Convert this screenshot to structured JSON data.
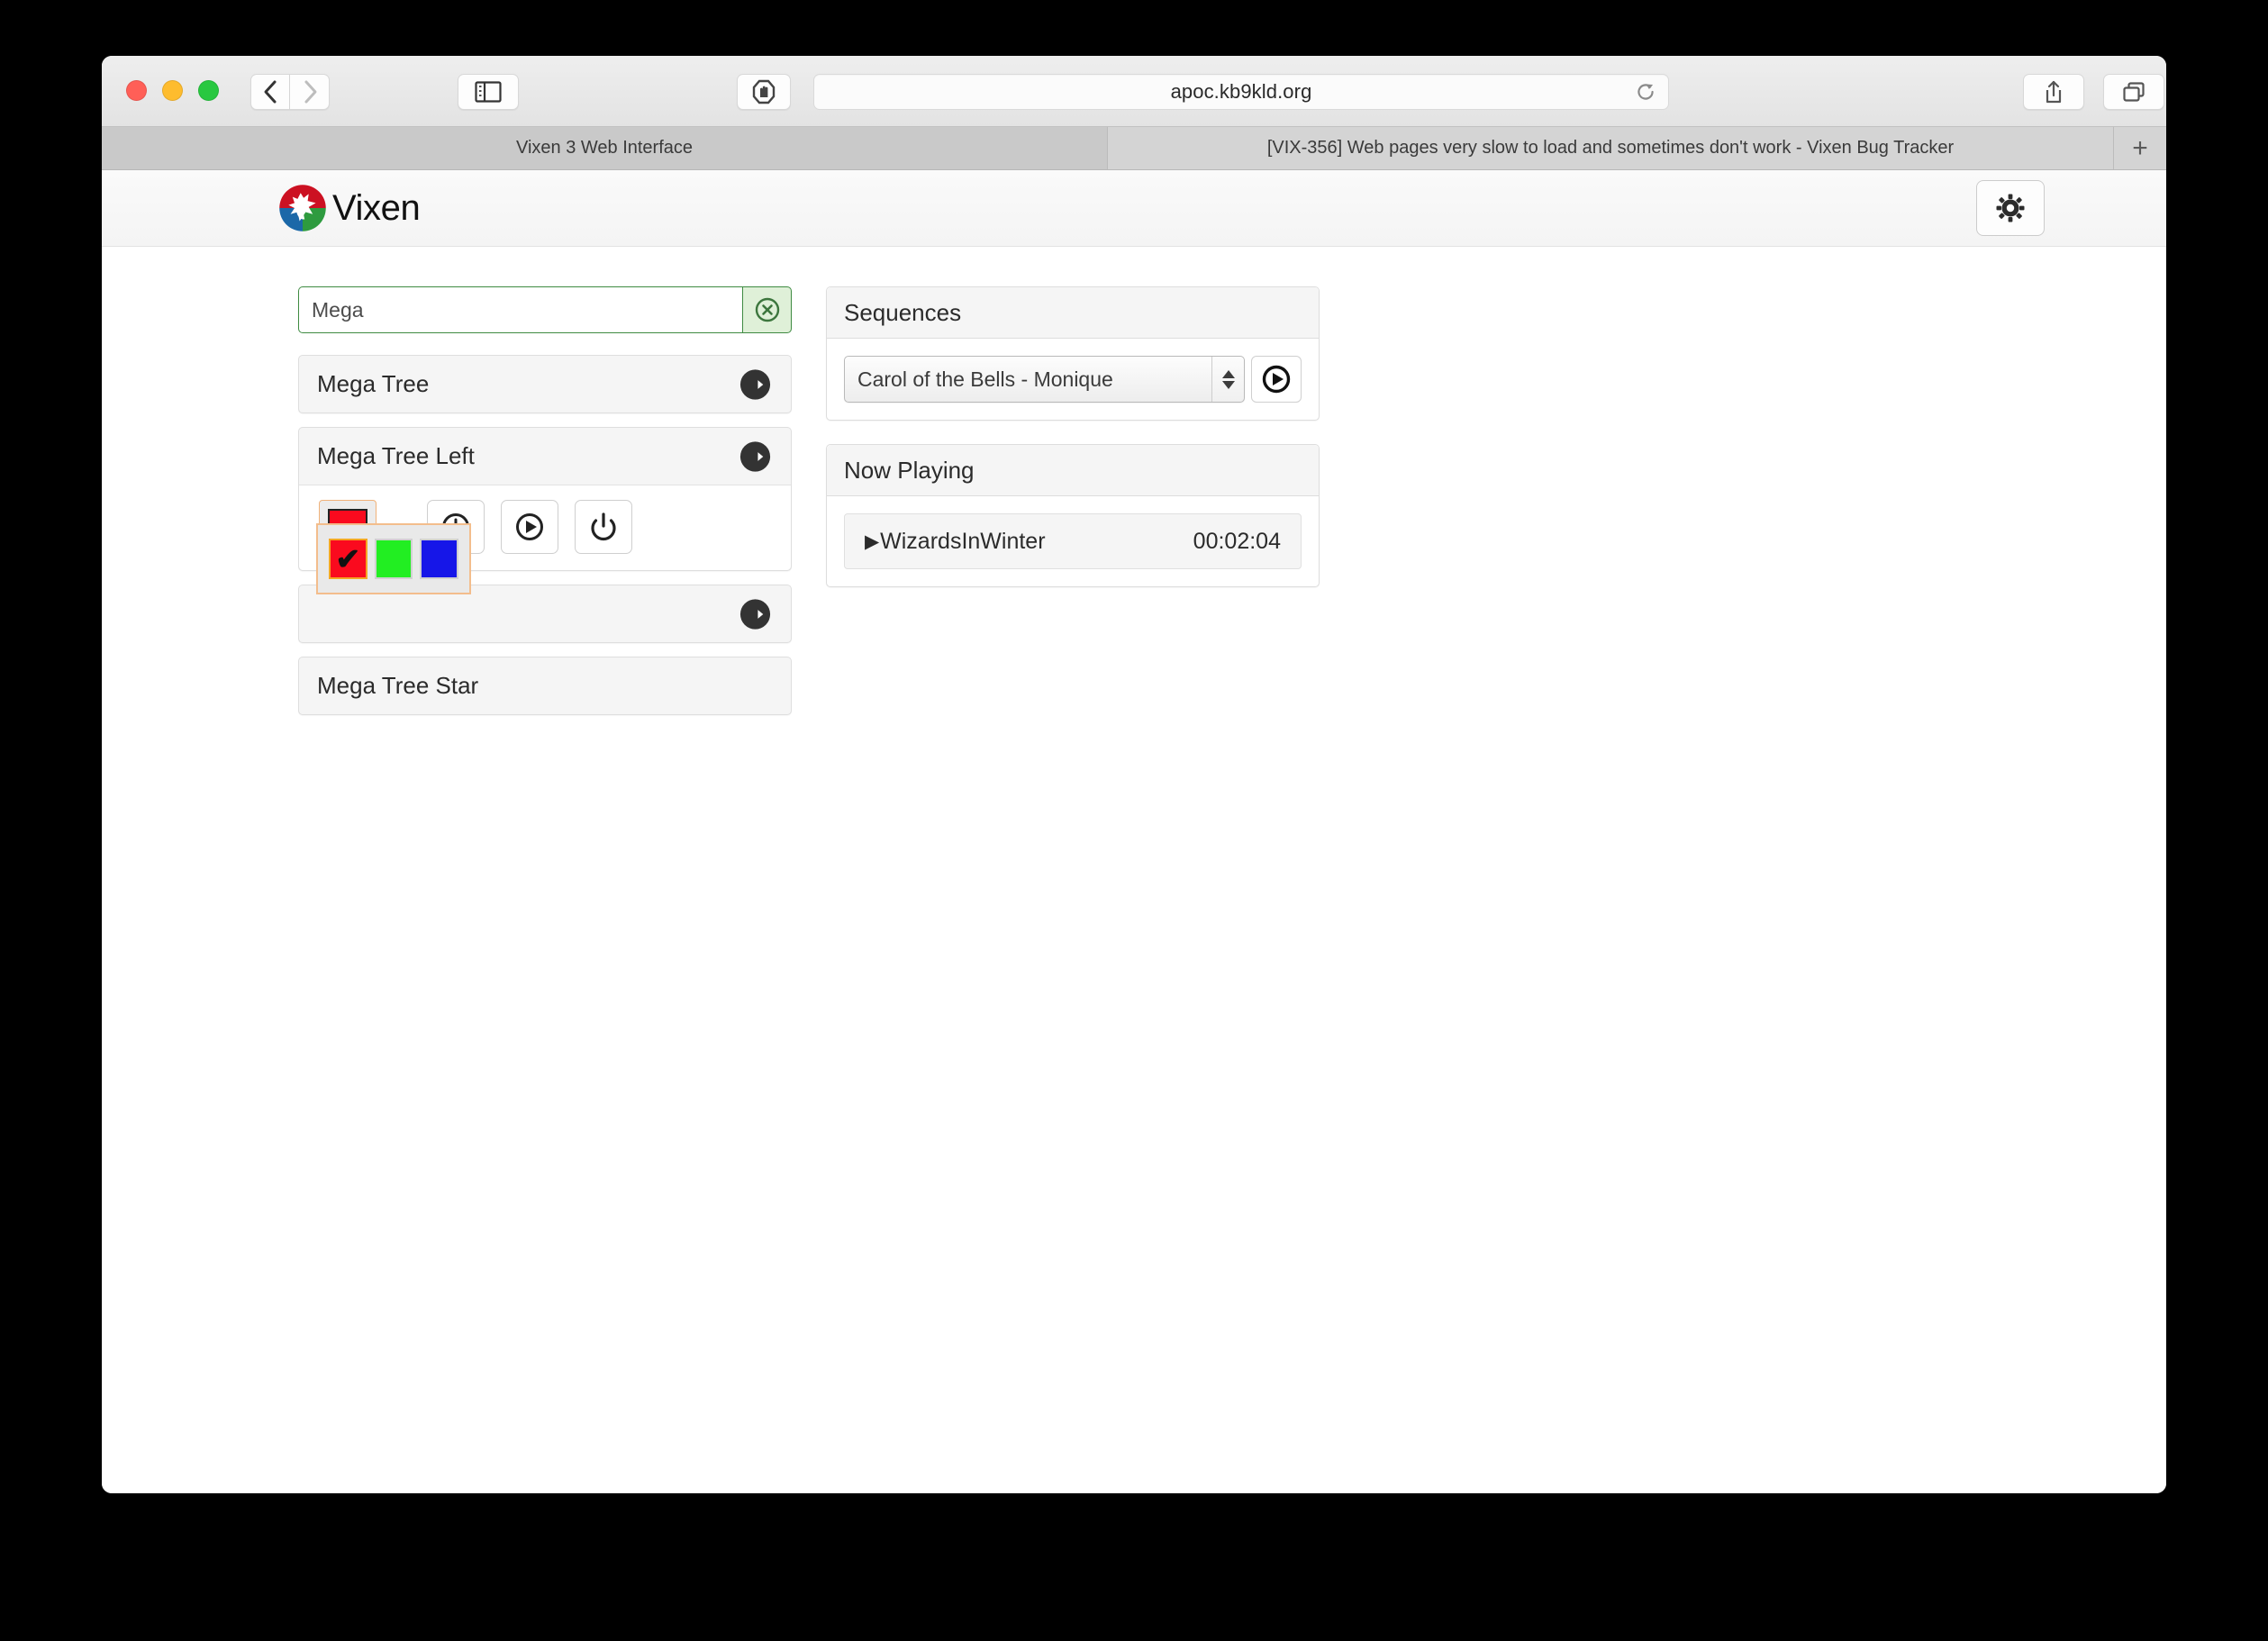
{
  "browser": {
    "url": "apoc.kb9kld.org",
    "icons": {
      "back": "back-chevron-icon",
      "forward": "forward-chevron-icon",
      "sidebar": "sidebar-toggle-icon",
      "shield": "content-blocker-icon",
      "reload": "reload-icon",
      "share": "share-icon",
      "tab_overview": "tab-overview-icon",
      "downloads": "downloads-icon"
    },
    "tabs": [
      {
        "label": "Vixen 3 Web Interface",
        "active": true
      },
      {
        "label": "[VIX-356] Web pages very slow to load and sometimes don't work - Vixen Bug Tracker",
        "active": false
      }
    ],
    "new_tab_label": "+"
  },
  "app": {
    "brand_name": "Vixen",
    "settings_icon": "gear-icon"
  },
  "search": {
    "value": "Mega",
    "placeholder": "",
    "clear_icon": "clear-circle-x-icon",
    "border_color": "#3f8b42",
    "clear_bg": "#dff0d8"
  },
  "elements": [
    {
      "label": "Mega Tree",
      "has_arrow": true,
      "expanded": false
    },
    {
      "label": "Mega Tree Left",
      "has_arrow": true,
      "expanded": true
    },
    {
      "label": "",
      "has_arrow": true,
      "expanded": false
    },
    {
      "label": "Mega Tree Star",
      "has_arrow": false,
      "expanded": false
    }
  ],
  "element_controls": {
    "color_swatch": "#fa0a1e",
    "buttons": [
      {
        "name": "schedule-button",
        "icon": "clock-icon"
      },
      {
        "name": "play-button",
        "icon": "play-circle-icon"
      },
      {
        "name": "power-button",
        "icon": "power-icon"
      }
    ]
  },
  "color_picker": {
    "visible": true,
    "border_color": "#f3bd8c",
    "swatches": [
      {
        "name": "red",
        "color": "#fa0a1e",
        "selected": true,
        "check": "✔"
      },
      {
        "name": "green",
        "color": "#22ee22",
        "selected": false,
        "check": ""
      },
      {
        "name": "blue",
        "color": "#1616e8",
        "selected": false,
        "check": ""
      }
    ]
  },
  "sequences": {
    "title": "Sequences",
    "selected": "Carol of the Bells - Monique",
    "play_icon": "play-circle-icon"
  },
  "now_playing": {
    "title": "Now Playing",
    "caret": "▶",
    "track": "WizardsInWinter",
    "time": "00:02:04"
  }
}
